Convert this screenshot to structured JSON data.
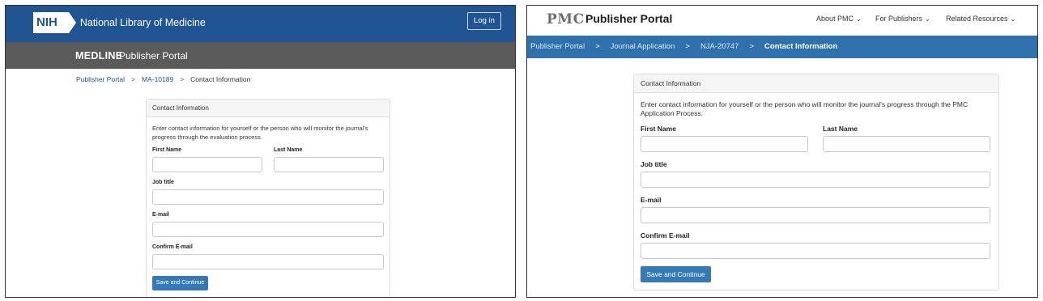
{
  "left_panel": {
    "header": {
      "logo_text": "NIH",
      "org_name": "National Library of Medicine",
      "login_label": "Log in",
      "bg_color": "#205493"
    },
    "subbar": {
      "brand": "MEDLINE",
      "portal_name": "Publisher Portal",
      "bg_color": "#5a5a5a"
    },
    "breadcrumb": {
      "items": [
        "Publisher Portal",
        "MA-10189",
        "Contact Information"
      ],
      "separator": ">"
    },
    "form": {
      "title": "Contact Information",
      "intro": "Enter contact information for yourself or the person who will monitor the journal's progress through the evaluation process.",
      "first_name_label": "First Name",
      "last_name_label": "Last Name",
      "job_title_label": "Job title",
      "email_label": "E-mail",
      "confirm_email_label": "Confirm E-mail",
      "submit_label": "Save and Continue"
    }
  },
  "right_panel": {
    "header": {
      "logo_text": "PMC",
      "title": "Publisher Portal",
      "nav": [
        {
          "label": "About PMC",
          "icon": "chevron-down-icon"
        },
        {
          "label": "For Publishers",
          "icon": "chevron-down-icon"
        },
        {
          "label": "Related Resources",
          "icon": "chevron-down-icon"
        }
      ]
    },
    "breadcrumb": {
      "items": [
        "Publisher Portal",
        "Journal Application",
        "NJA-20747",
        "Contact Information"
      ],
      "separator": ">",
      "bg_color": "#2f71ad"
    },
    "form": {
      "title": "Contact Information",
      "intro": "Enter contact information for yourself or the person who will monitor the journal's progress through the PMC Application Process.",
      "first_name_label": "First Name",
      "last_name_label": "Last Name",
      "job_title_label": "Job title",
      "email_label": "E-mail",
      "confirm_email_label": "Confirm E-mail",
      "submit_label": "Save and Continue"
    }
  },
  "colors": {
    "button_blue": "#337ab7",
    "link_blue": "#205493"
  }
}
